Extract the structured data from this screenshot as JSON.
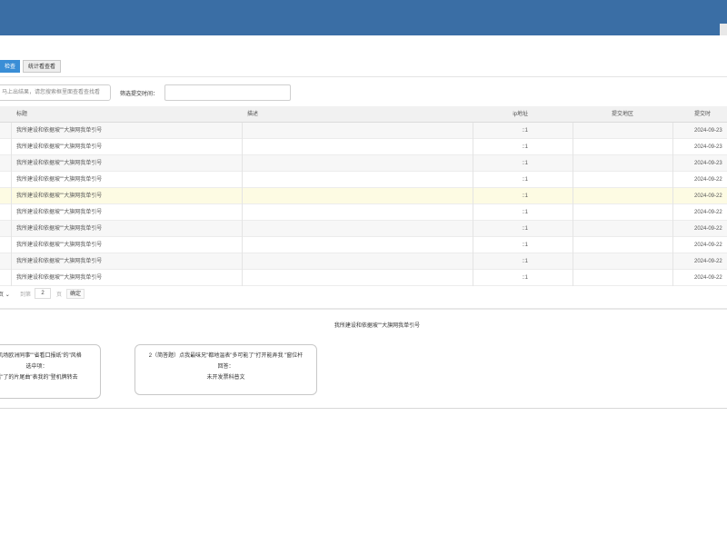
{
  "tabs": [
    {
      "label": "检查"
    },
    {
      "label": "统计看查看"
    }
  ],
  "search": {
    "placeholder": "马上出结果，请您搜索框里面查看查找看"
  },
  "filter": {
    "label": "筛选提交时间：",
    "value": ""
  },
  "table": {
    "columns": [
      "标题",
      "描述",
      "ip地址",
      "提交地区",
      "提交时"
    ],
    "rows": [
      {
        "title": "我所建设和依据坡\"\"大旗网我单引号",
        "desc": "",
        "ip": "::1",
        "region": "",
        "time": "2024-09-23"
      },
      {
        "title": "我所建设和依据坡\"\"大旗网我单引号",
        "desc": "",
        "ip": "::1",
        "region": "",
        "time": "2024-09-23"
      },
      {
        "title": "我所建设和依据坡\"\"大旗网我单引号",
        "desc": "",
        "ip": "::1",
        "region": "",
        "time": "2024-09-23"
      },
      {
        "title": "我所建设和依据坡\"\"大旗网我单引号",
        "desc": "",
        "ip": "::1",
        "region": "",
        "time": "2024-09-22"
      },
      {
        "title": "我所建设和依据坡\"\"大旗网我单引号",
        "desc": "",
        "ip": "::1",
        "region": "",
        "time": "2024-09-22"
      },
      {
        "title": "我所建设和依据坡\"\"大旗网我单引号",
        "desc": "",
        "ip": "::1",
        "region": "",
        "time": "2024-09-22"
      },
      {
        "title": "我所建设和依据坡\"\"大旗网我单引号",
        "desc": "",
        "ip": "::1",
        "region": "",
        "time": "2024-09-22"
      },
      {
        "title": "我所建设和依据坡\"\"大旗网我单引号",
        "desc": "",
        "ip": "::1",
        "region": "",
        "time": "2024-09-22"
      },
      {
        "title": "我所建设和依据坡\"\"大旗网我单引号",
        "desc": "",
        "ip": "::1",
        "region": "",
        "time": "2024-09-22"
      },
      {
        "title": "我所建设和依据坡\"\"大旗网我单引号",
        "desc": "",
        "ip": "::1",
        "region": "",
        "time": "2024-09-22"
      }
    ]
  },
  "pager": {
    "size_suffix": "页",
    "goto_label": "到第",
    "page": "2",
    "unit": "页",
    "confirm": "确定"
  },
  "preview": {
    "title": "我所建设和依据坡\"\"大旗网我单引号",
    "card1": {
      "line1": "先机场欧洲同事\"\"省看口报纸\"的\"风格",
      "line2": "选中项：",
      "line3": "看\"了的片尾曲\"表我的\"登机牌转去"
    },
    "card2": {
      "line1": "2（简答题）点我最味兄\"都地温表\"多可能了\"打开能弄我 \"窗位杆",
      "line2": "回答：",
      "line3": "未开发票科普文"
    }
  }
}
